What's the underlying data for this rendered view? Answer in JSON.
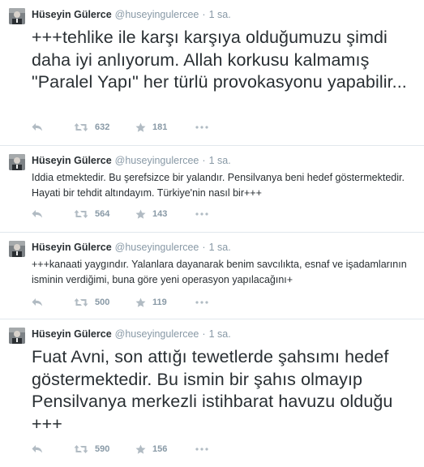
{
  "tweets": [
    {
      "name": "Hüseyin Gülerce",
      "handle": "@huseyingulercee",
      "time": "1 sa.",
      "text": "+++tehlike ile karşı karşıya olduğumuzu şimdi daha iyi anlıyorum. Allah korkusu kalmamış \"Paralel Yapı\" her türlü provokasyonu yapabilir...",
      "size": "large",
      "retweets": "632",
      "favorites": "181"
    },
    {
      "name": "Hüseyin Gülerce",
      "handle": "@huseyingulercee",
      "time": "1 sa.",
      "text": "Iddia etmektedir. Bu şerefsizce bir yalandır. Pensilvanya beni hedef göstermektedir. Hayati bir tehdit altındayım. Türkiye'nin nasıl bir+++",
      "size": "small",
      "retweets": "564",
      "favorites": "143"
    },
    {
      "name": "Hüseyin Gülerce",
      "handle": "@huseyingulercee",
      "time": "1 sa.",
      "text": "+++kanaati yaygındır. Yalanlara dayanarak benim savcılıkta, esnaf ve işadamlarının isminin verdiğimi, buna göre yeni operasyon yapılacağını+",
      "size": "small",
      "retweets": "500",
      "favorites": "119"
    },
    {
      "name": "Hüseyin Gülerce",
      "handle": "@huseyingulercee",
      "time": "1 sa.",
      "text": "Fuat Avni, son attığı tewetlerde şahsımı hedef göstermektedir. Bu ismin bir şahıs olmayıp Pensilvanya merkezli istihbarat havuzu olduğu +++",
      "size": "large",
      "retweets": "590",
      "favorites": "156"
    }
  ],
  "icons": {
    "reply": "reply-icon",
    "retweet": "retweet-icon",
    "favorite": "star-icon",
    "more": "more-dots-icon"
  },
  "colors": {
    "text": "#292f33",
    "muted": "#8899a6",
    "divider": "#e1e8ed",
    "icon": "#b1bbc3"
  }
}
